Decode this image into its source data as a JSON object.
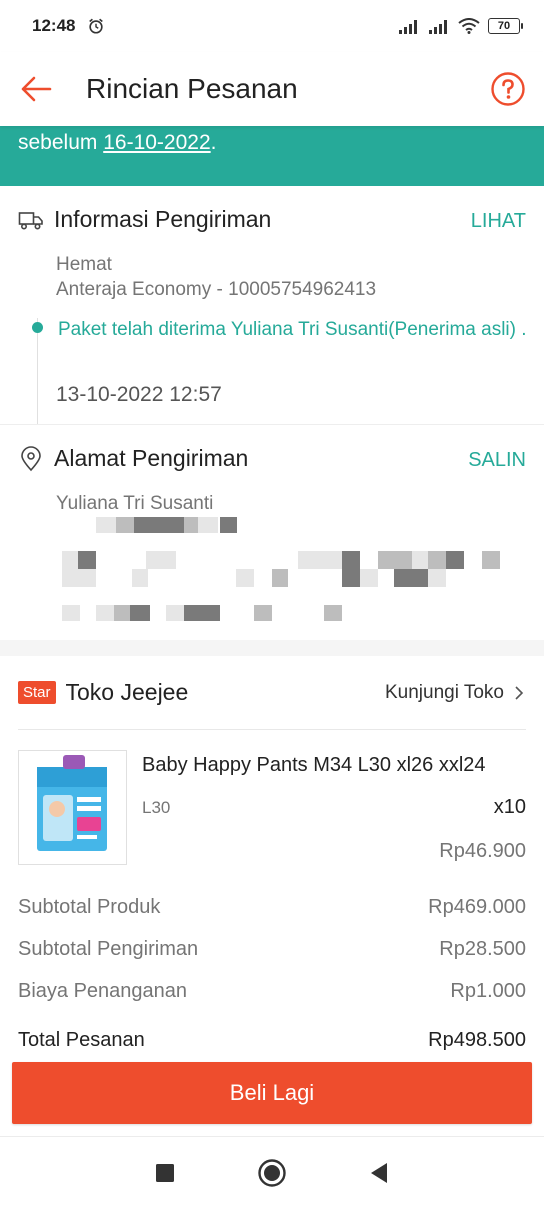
{
  "status_bar": {
    "time": "12:48",
    "battery": "70"
  },
  "app_bar": {
    "title": "Rincian Pesanan"
  },
  "banner": {
    "prefix": "sebelum ",
    "date": "16-10-2022",
    "suffix": "."
  },
  "shipping": {
    "title": "Informasi Pengiriman",
    "action": "LIHAT",
    "service": "Hemat",
    "courier": "Anteraja Economy - 10005754962413",
    "status": "Paket telah diterima Yuliana Tri Susanti(Penerima asli) .",
    "timestamp": "13-10-2022 12:57"
  },
  "address": {
    "title": "Alamat Pengiriman",
    "action": "SALIN",
    "name": "Yuliana Tri Susanti"
  },
  "store": {
    "badge": "Star",
    "name": "Toko Jeejee",
    "visit": "Kunjungi Toko"
  },
  "product": {
    "name": "Baby Happy Pants M34 L30 xl26 xxl24",
    "variant": "L30",
    "qty": "x10",
    "price": "Rp46.900"
  },
  "summary": {
    "subtotal_product_label": "Subtotal Produk",
    "subtotal_product_value": "Rp469.000",
    "subtotal_shipping_label": "Subtotal Pengiriman",
    "subtotal_shipping_value": "Rp28.500",
    "handling_label": "Biaya Penanganan",
    "handling_value": "Rp1.000",
    "total_label": "Total Pesanan",
    "total_value": "Rp498.500"
  },
  "buy_again": "Beli Lagi",
  "colors": {
    "brand": "#ee4d2d",
    "teal": "#26aa99"
  }
}
